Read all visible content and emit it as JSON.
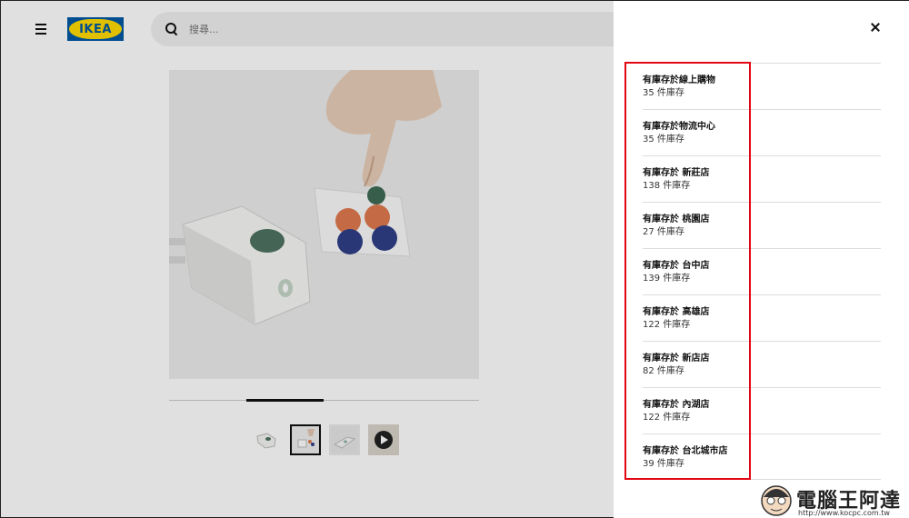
{
  "header": {
    "logo_text": "IKEA",
    "search_placeholder": "搜尋..."
  },
  "gallery": {
    "thumbnails": [
      "charger",
      "charger-with-stickers",
      "charger-side",
      "video"
    ],
    "active_thumbnail": 1,
    "position_fraction": 0.25
  },
  "drawer": {
    "stores": [
      {
        "name": "有庫存於線上購物",
        "stock": "35 件庫存"
      },
      {
        "name": "有庫存於物流中心",
        "stock": "35 件庫存"
      },
      {
        "name": "有庫存於 新莊店",
        "stock": "138 件庫存"
      },
      {
        "name": "有庫存於 桃園店",
        "stock": "27 件庫存"
      },
      {
        "name": "有庫存於 台中店",
        "stock": "139 件庫存"
      },
      {
        "name": "有庫存於 高雄店",
        "stock": "122 件庫存"
      },
      {
        "name": "有庫存於 新店店",
        "stock": "82 件庫存"
      },
      {
        "name": "有庫存於 內湖店",
        "stock": "122 件庫存"
      },
      {
        "name": "有庫存於 台北城市店",
        "stock": "39 件庫存"
      }
    ]
  },
  "watermark": {
    "text": "電腦王阿達",
    "url": "http://www.kocpc.com.tw"
  },
  "colors": {
    "brand_blue": "#0058a3",
    "brand_yellow": "#ffdb00",
    "highlight_red": "#e30613"
  }
}
